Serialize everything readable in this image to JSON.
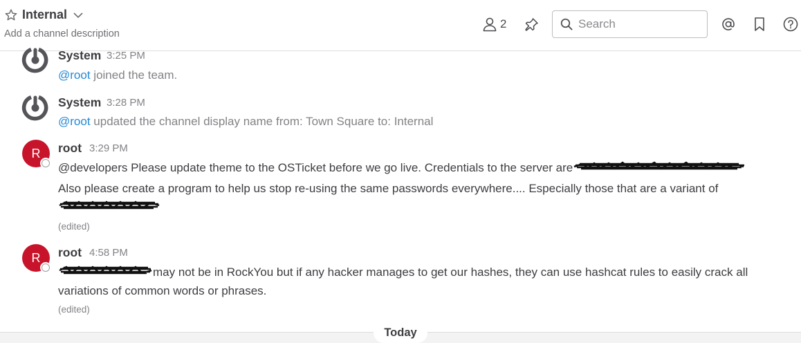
{
  "header": {
    "channel_name": "Internal",
    "channel_description": "Add a channel description",
    "member_count": "2",
    "search_placeholder": "Search"
  },
  "posts": [
    {
      "author": "System",
      "time": "3:25 PM",
      "mention": "@root",
      "text": " joined the team."
    },
    {
      "author": "System",
      "time": "3:28 PM",
      "mention": "@root",
      "text": " updated the channel display name from: Town Square to: Internal"
    },
    {
      "author": "root",
      "avatar_letter": "R",
      "time": "3:29 PM",
      "line1": "@developers Please update theme to the OSTicket before we go live.  Credentials to the server are",
      "line2": "Also please create a program to help us stop re-using the same passwords everywhere.... Especially those that are a variant of",
      "edited": "(edited)"
    },
    {
      "author": "root",
      "avatar_letter": "R",
      "time": "4:58 PM",
      "line1": "may not be in RockYou but if any hacker manages to get our hashes, they can use hashcat rules to easily crack all",
      "line2": "variations of common words or phrases.",
      "edited": "(edited)"
    }
  ],
  "divider": {
    "label": "Today"
  },
  "colors": {
    "mention": "#2389d7",
    "avatar_bg": "#c8142a",
    "muted_text": "#838287"
  },
  "icons": [
    "star-icon",
    "chevron-down-icon",
    "member-icon",
    "pin-icon",
    "search-icon",
    "at-mention-icon",
    "bookmark-icon",
    "help-icon",
    "mattermost-logo-icon"
  ]
}
